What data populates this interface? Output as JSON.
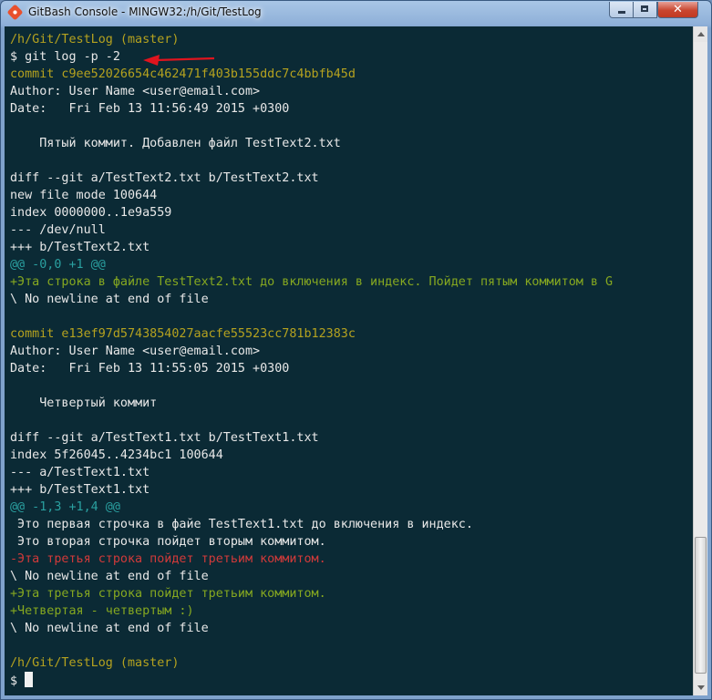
{
  "window": {
    "title": "GitBash Console - MINGW32:/h/Git/TestLog",
    "close_glyph": "✕"
  },
  "terminal": {
    "lines": [
      {
        "text": "/h/Git/TestLog (master)",
        "color": "prompt"
      },
      {
        "text": "$ git log -p -2",
        "color": "white"
      },
      {
        "text": "commit c9ee52026654c462471f403b155ddc7c4bbfb45d",
        "color": "yellow"
      },
      {
        "text": "Author: User Name <user@email.com>",
        "color": "white"
      },
      {
        "text": "Date:   Fri Feb 13 11:56:49 2015 +0300",
        "color": "white"
      },
      {
        "text": "",
        "color": "white"
      },
      {
        "text": "    Пятый коммит. Добавлен файл TestText2.txt",
        "color": "white"
      },
      {
        "text": "",
        "color": "white"
      },
      {
        "text": "diff --git a/TestText2.txt b/TestText2.txt",
        "color": "white"
      },
      {
        "text": "new file mode 100644",
        "color": "white"
      },
      {
        "text": "index 0000000..1e9a559",
        "color": "white"
      },
      {
        "text": "--- /dev/null",
        "color": "white"
      },
      {
        "text": "+++ b/TestText2.txt",
        "color": "white"
      },
      {
        "text": "@@ -0,0 +1 @@",
        "color": "cyan"
      },
      {
        "text": "+Эта строка в файле TestText2.txt до включения в индекс. Пойдет пятым коммитом в G",
        "color": "green"
      },
      {
        "text": "\\ No newline at end of file",
        "color": "white"
      },
      {
        "text": "",
        "color": "white"
      },
      {
        "text": "commit e13ef97d5743854027aacfe55523cc781b12383c",
        "color": "yellow"
      },
      {
        "text": "Author: User Name <user@email.com>",
        "color": "white"
      },
      {
        "text": "Date:   Fri Feb 13 11:55:05 2015 +0300",
        "color": "white"
      },
      {
        "text": "",
        "color": "white"
      },
      {
        "text": "    Четвертый коммит",
        "color": "white"
      },
      {
        "text": "",
        "color": "white"
      },
      {
        "text": "diff --git a/TestText1.txt b/TestText1.txt",
        "color": "white"
      },
      {
        "text": "index 5f26045..4234bc1 100644",
        "color": "white"
      },
      {
        "text": "--- a/TestText1.txt",
        "color": "white"
      },
      {
        "text": "+++ b/TestText1.txt",
        "color": "white"
      },
      {
        "text": "@@ -1,3 +1,4 @@",
        "color": "cyan"
      },
      {
        "text": " Это первая строчка в файе TestText1.txt до включения в индекс.",
        "color": "white"
      },
      {
        "text": " Это вторая строчка пойдет вторым коммитом.",
        "color": "white"
      },
      {
        "text": "-Эта третья строка пойдет третьим коммитом.",
        "color": "red"
      },
      {
        "text": "\\ No newline at end of file",
        "color": "white"
      },
      {
        "text": "+Эта третья строка пойдет третьим коммитом.",
        "color": "green"
      },
      {
        "text": "+Четвертая - четвертым :)",
        "color": "green"
      },
      {
        "text": "\\ No newline at end of file",
        "color": "white"
      },
      {
        "text": "",
        "color": "white"
      },
      {
        "text": "/h/Git/TestLog (master)",
        "color": "prompt"
      },
      {
        "text": "$ ",
        "color": "white",
        "cursor": true
      }
    ]
  },
  "annotation": {
    "color": "#e0141e"
  },
  "colors": {
    "background": "#0b2a35",
    "white": "#e8e8e8",
    "yellow": "#b5a21f",
    "cyan": "#2aa0a0",
    "green": "#86a820",
    "red": "#d13a3a"
  }
}
